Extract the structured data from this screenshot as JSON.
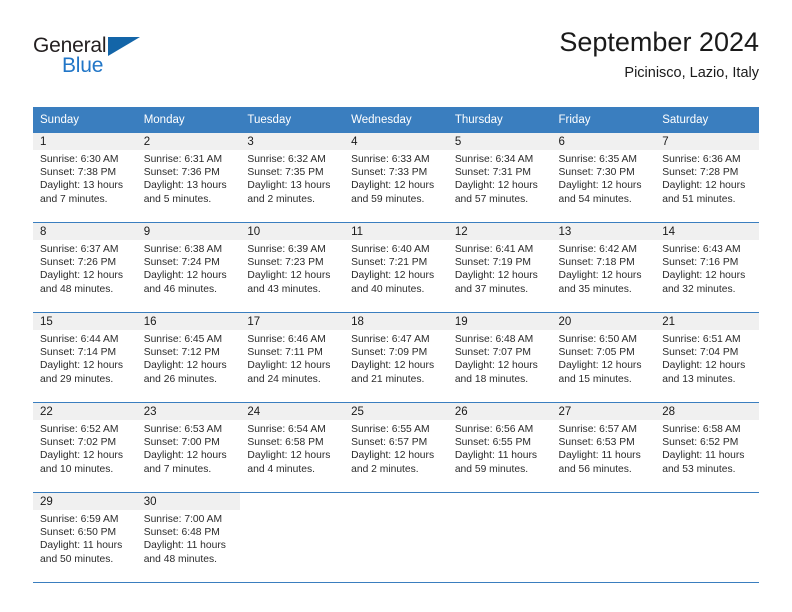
{
  "brand": {
    "name_part1": "General",
    "name_part2": "Blue",
    "logo_icon": "triangle-logo-icon"
  },
  "header": {
    "title": "September 2024",
    "subtitle": "Picinisco, Lazio, Italy"
  },
  "colors": {
    "header_blue": "#3a7ebf",
    "brand_blue": "#2176c7",
    "logo_blue": "#1365a8",
    "daynum_band": "#f0f0f0",
    "text": "#1a1a1a"
  },
  "weekdays": [
    "Sunday",
    "Monday",
    "Tuesday",
    "Wednesday",
    "Thursday",
    "Friday",
    "Saturday"
  ],
  "weeks": [
    [
      {
        "day": "1",
        "sunrise": "Sunrise: 6:30 AM",
        "sunset": "Sunset: 7:38 PM",
        "daylight_line1": "Daylight: 13 hours",
        "daylight_line2": "and 7 minutes."
      },
      {
        "day": "2",
        "sunrise": "Sunrise: 6:31 AM",
        "sunset": "Sunset: 7:36 PM",
        "daylight_line1": "Daylight: 13 hours",
        "daylight_line2": "and 5 minutes."
      },
      {
        "day": "3",
        "sunrise": "Sunrise: 6:32 AM",
        "sunset": "Sunset: 7:35 PM",
        "daylight_line1": "Daylight: 13 hours",
        "daylight_line2": "and 2 minutes."
      },
      {
        "day": "4",
        "sunrise": "Sunrise: 6:33 AM",
        "sunset": "Sunset: 7:33 PM",
        "daylight_line1": "Daylight: 12 hours",
        "daylight_line2": "and 59 minutes."
      },
      {
        "day": "5",
        "sunrise": "Sunrise: 6:34 AM",
        "sunset": "Sunset: 7:31 PM",
        "daylight_line1": "Daylight: 12 hours",
        "daylight_line2": "and 57 minutes."
      },
      {
        "day": "6",
        "sunrise": "Sunrise: 6:35 AM",
        "sunset": "Sunset: 7:30 PM",
        "daylight_line1": "Daylight: 12 hours",
        "daylight_line2": "and 54 minutes."
      },
      {
        "day": "7",
        "sunrise": "Sunrise: 6:36 AM",
        "sunset": "Sunset: 7:28 PM",
        "daylight_line1": "Daylight: 12 hours",
        "daylight_line2": "and 51 minutes."
      }
    ],
    [
      {
        "day": "8",
        "sunrise": "Sunrise: 6:37 AM",
        "sunset": "Sunset: 7:26 PM",
        "daylight_line1": "Daylight: 12 hours",
        "daylight_line2": "and 48 minutes."
      },
      {
        "day": "9",
        "sunrise": "Sunrise: 6:38 AM",
        "sunset": "Sunset: 7:24 PM",
        "daylight_line1": "Daylight: 12 hours",
        "daylight_line2": "and 46 minutes."
      },
      {
        "day": "10",
        "sunrise": "Sunrise: 6:39 AM",
        "sunset": "Sunset: 7:23 PM",
        "daylight_line1": "Daylight: 12 hours",
        "daylight_line2": "and 43 minutes."
      },
      {
        "day": "11",
        "sunrise": "Sunrise: 6:40 AM",
        "sunset": "Sunset: 7:21 PM",
        "daylight_line1": "Daylight: 12 hours",
        "daylight_line2": "and 40 minutes."
      },
      {
        "day": "12",
        "sunrise": "Sunrise: 6:41 AM",
        "sunset": "Sunset: 7:19 PM",
        "daylight_line1": "Daylight: 12 hours",
        "daylight_line2": "and 37 minutes."
      },
      {
        "day": "13",
        "sunrise": "Sunrise: 6:42 AM",
        "sunset": "Sunset: 7:18 PM",
        "daylight_line1": "Daylight: 12 hours",
        "daylight_line2": "and 35 minutes."
      },
      {
        "day": "14",
        "sunrise": "Sunrise: 6:43 AM",
        "sunset": "Sunset: 7:16 PM",
        "daylight_line1": "Daylight: 12 hours",
        "daylight_line2": "and 32 minutes."
      }
    ],
    [
      {
        "day": "15",
        "sunrise": "Sunrise: 6:44 AM",
        "sunset": "Sunset: 7:14 PM",
        "daylight_line1": "Daylight: 12 hours",
        "daylight_line2": "and 29 minutes."
      },
      {
        "day": "16",
        "sunrise": "Sunrise: 6:45 AM",
        "sunset": "Sunset: 7:12 PM",
        "daylight_line1": "Daylight: 12 hours",
        "daylight_line2": "and 26 minutes."
      },
      {
        "day": "17",
        "sunrise": "Sunrise: 6:46 AM",
        "sunset": "Sunset: 7:11 PM",
        "daylight_line1": "Daylight: 12 hours",
        "daylight_line2": "and 24 minutes."
      },
      {
        "day": "18",
        "sunrise": "Sunrise: 6:47 AM",
        "sunset": "Sunset: 7:09 PM",
        "daylight_line1": "Daylight: 12 hours",
        "daylight_line2": "and 21 minutes."
      },
      {
        "day": "19",
        "sunrise": "Sunrise: 6:48 AM",
        "sunset": "Sunset: 7:07 PM",
        "daylight_line1": "Daylight: 12 hours",
        "daylight_line2": "and 18 minutes."
      },
      {
        "day": "20",
        "sunrise": "Sunrise: 6:50 AM",
        "sunset": "Sunset: 7:05 PM",
        "daylight_line1": "Daylight: 12 hours",
        "daylight_line2": "and 15 minutes."
      },
      {
        "day": "21",
        "sunrise": "Sunrise: 6:51 AM",
        "sunset": "Sunset: 7:04 PM",
        "daylight_line1": "Daylight: 12 hours",
        "daylight_line2": "and 13 minutes."
      }
    ],
    [
      {
        "day": "22",
        "sunrise": "Sunrise: 6:52 AM",
        "sunset": "Sunset: 7:02 PM",
        "daylight_line1": "Daylight: 12 hours",
        "daylight_line2": "and 10 minutes."
      },
      {
        "day": "23",
        "sunrise": "Sunrise: 6:53 AM",
        "sunset": "Sunset: 7:00 PM",
        "daylight_line1": "Daylight: 12 hours",
        "daylight_line2": "and 7 minutes."
      },
      {
        "day": "24",
        "sunrise": "Sunrise: 6:54 AM",
        "sunset": "Sunset: 6:58 PM",
        "daylight_line1": "Daylight: 12 hours",
        "daylight_line2": "and 4 minutes."
      },
      {
        "day": "25",
        "sunrise": "Sunrise: 6:55 AM",
        "sunset": "Sunset: 6:57 PM",
        "daylight_line1": "Daylight: 12 hours",
        "daylight_line2": "and 2 minutes."
      },
      {
        "day": "26",
        "sunrise": "Sunrise: 6:56 AM",
        "sunset": "Sunset: 6:55 PM",
        "daylight_line1": "Daylight: 11 hours",
        "daylight_line2": "and 59 minutes."
      },
      {
        "day": "27",
        "sunrise": "Sunrise: 6:57 AM",
        "sunset": "Sunset: 6:53 PM",
        "daylight_line1": "Daylight: 11 hours",
        "daylight_line2": "and 56 minutes."
      },
      {
        "day": "28",
        "sunrise": "Sunrise: 6:58 AM",
        "sunset": "Sunset: 6:52 PM",
        "daylight_line1": "Daylight: 11 hours",
        "daylight_line2": "and 53 minutes."
      }
    ],
    [
      {
        "day": "29",
        "sunrise": "Sunrise: 6:59 AM",
        "sunset": "Sunset: 6:50 PM",
        "daylight_line1": "Daylight: 11 hours",
        "daylight_line2": "and 50 minutes."
      },
      {
        "day": "30",
        "sunrise": "Sunrise: 7:00 AM",
        "sunset": "Sunset: 6:48 PM",
        "daylight_line1": "Daylight: 11 hours",
        "daylight_line2": "and 48 minutes."
      },
      {
        "day": "",
        "sunrise": "",
        "sunset": "",
        "daylight_line1": "",
        "daylight_line2": ""
      },
      {
        "day": "",
        "sunrise": "",
        "sunset": "",
        "daylight_line1": "",
        "daylight_line2": ""
      },
      {
        "day": "",
        "sunrise": "",
        "sunset": "",
        "daylight_line1": "",
        "daylight_line2": ""
      },
      {
        "day": "",
        "sunrise": "",
        "sunset": "",
        "daylight_line1": "",
        "daylight_line2": ""
      },
      {
        "day": "",
        "sunrise": "",
        "sunset": "",
        "daylight_line1": "",
        "daylight_line2": ""
      }
    ]
  ]
}
